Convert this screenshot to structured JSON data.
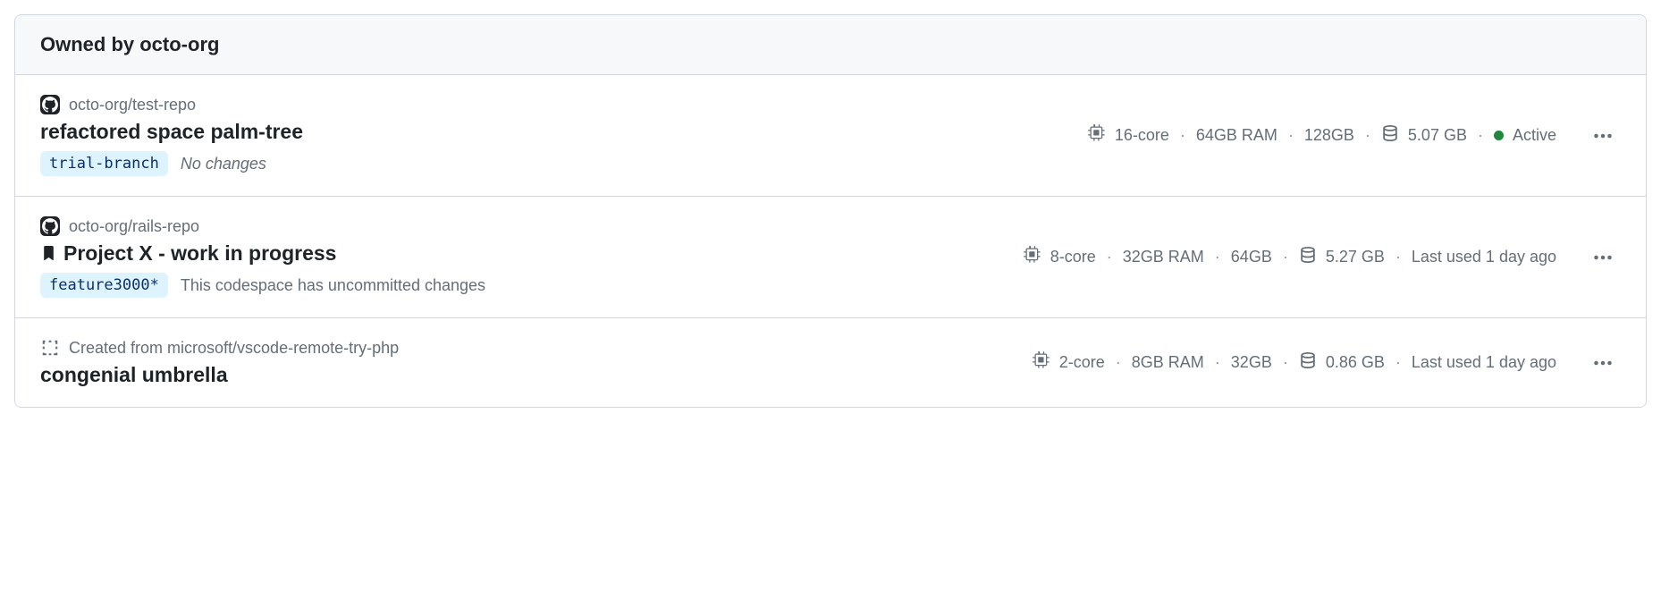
{
  "header": {
    "title": "Owned by octo-org"
  },
  "rows": [
    {
      "repo": "octo-org/test-repo",
      "avatar": "github",
      "bookmarked": false,
      "name": "refactored space palm-tree",
      "branch": "trial-branch",
      "branch_status": "No changes",
      "branch_status_style": "italic",
      "specs": {
        "cores": "16-core",
        "ram": "64GB RAM",
        "disk": "128GB"
      },
      "storage": "5.07 GB",
      "status": {
        "label": "Active",
        "type": "active"
      }
    },
    {
      "repo": "octo-org/rails-repo",
      "avatar": "github",
      "bookmarked": true,
      "name": "Project X - work in progress",
      "branch": "feature3000*",
      "branch_status": "This codespace has uncommitted changes",
      "branch_status_style": "plain",
      "specs": {
        "cores": "8-core",
        "ram": "32GB RAM",
        "disk": "64GB"
      },
      "storage": "5.27 GB",
      "status": {
        "label": "Last used 1 day ago",
        "type": "last-used"
      }
    },
    {
      "repo": "Created from microsoft/vscode-remote-try-php",
      "avatar": "template",
      "bookmarked": false,
      "name": "congenial umbrella",
      "branch": null,
      "branch_status": null,
      "specs": {
        "cores": "2-core",
        "ram": "8GB RAM",
        "disk": "32GB"
      },
      "storage": "0.86 GB",
      "status": {
        "label": "Last used 1 day ago",
        "type": "last-used"
      }
    }
  ]
}
